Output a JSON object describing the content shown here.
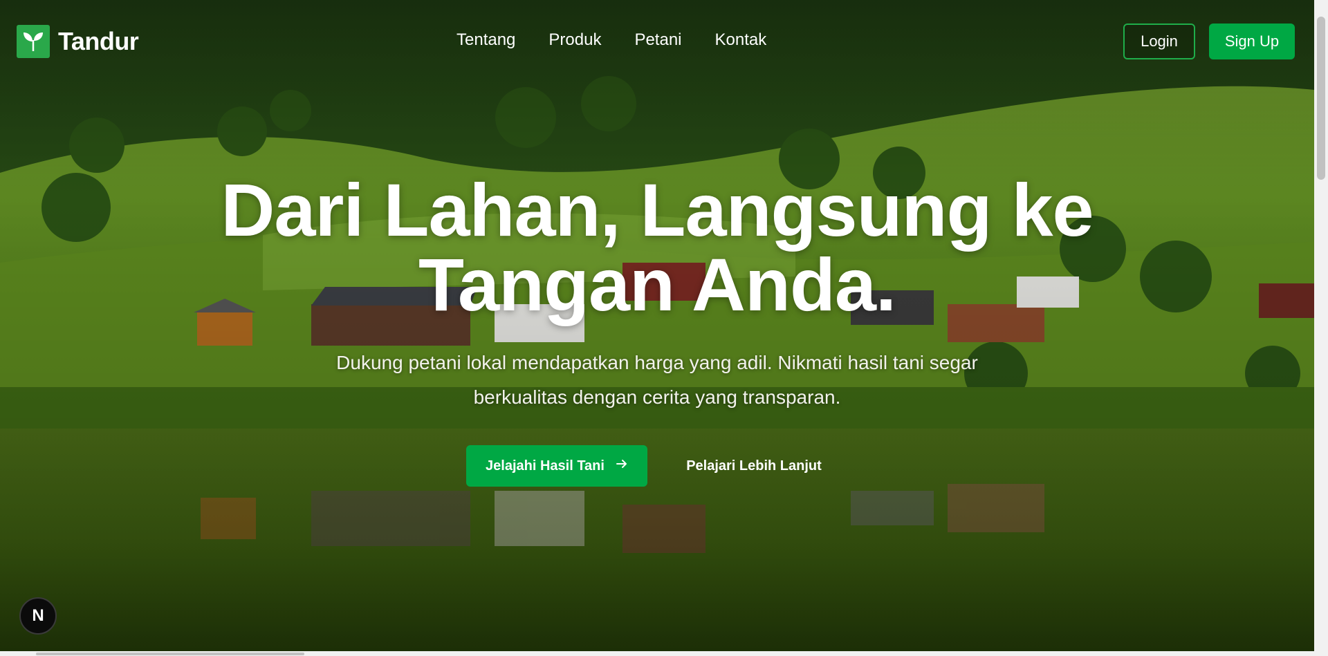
{
  "brand": {
    "name": "Tandur",
    "logo_icon": "sprout-icon"
  },
  "nav": {
    "links": [
      {
        "label": "Tentang"
      },
      {
        "label": "Produk"
      },
      {
        "label": "Petani"
      },
      {
        "label": "Kontak"
      }
    ],
    "login_label": "Login",
    "signup_label": "Sign Up"
  },
  "hero": {
    "title": "Dari Lahan, Langsung ke Tangan Anda.",
    "subtitle": "Dukung petani lokal mendapatkan harga yang adil. Nikmati hasil tani segar berkualitas dengan cerita yang transparan.",
    "primary_cta": "Jelajahi Hasil Tani",
    "primary_cta_icon": "arrow-right-icon",
    "secondary_cta": "Pelajari Lebih Lanjut"
  },
  "dev_badge": {
    "label": "N",
    "icon": "nextjs-icon"
  },
  "colors": {
    "accent": "#00a844",
    "logo_bg": "#2aa84a",
    "text": "#ffffff"
  }
}
